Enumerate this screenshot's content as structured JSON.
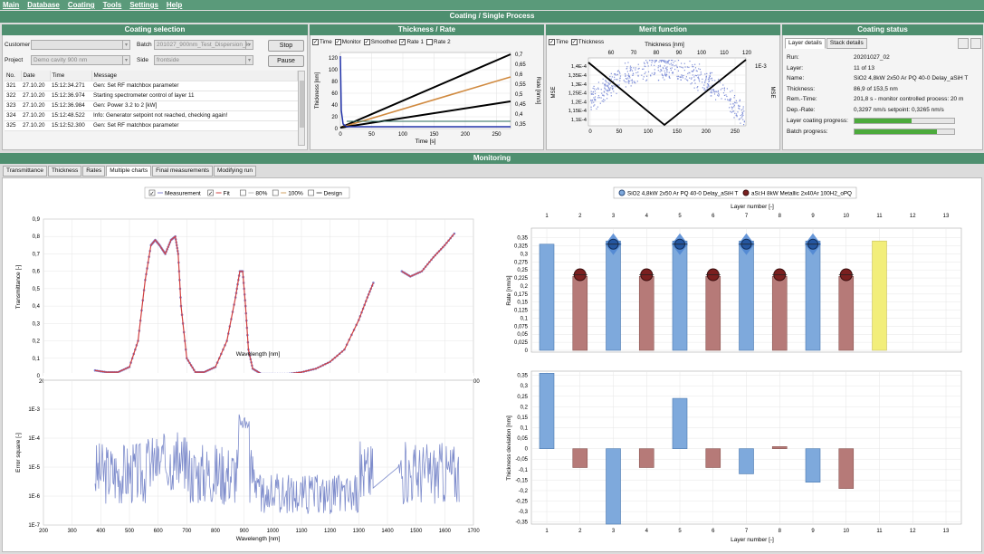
{
  "menu": [
    "Main",
    "Database",
    "Coating",
    "Tools",
    "Settings",
    "Help"
  ],
  "title": "Coating / Single Process",
  "coating_selection": {
    "header": "Coating selection",
    "customer_label": "Customer",
    "customer_value": "",
    "project_label": "Project",
    "project_value": "Demo cavity 900 nm",
    "batch_label": "Batch",
    "batch_value": "201027_900nm_Test_Dispersion_k",
    "side_label": "Side",
    "side_value": "frontside",
    "stop_label": "Stop",
    "pause_label": "Pause",
    "log_columns": [
      "No.",
      "Date",
      "Time",
      "Message"
    ],
    "log_rows": [
      [
        "321",
        "27.10.20",
        "15:12:34.271",
        "Gen: Set RF matchbox parameter"
      ],
      [
        "322",
        "27.10.20",
        "15:12:36.974",
        "Starting spectrometer control of layer 11"
      ],
      [
        "323",
        "27.10.20",
        "15:12:36.984",
        "Gen: Power 3.2 to 2 [kW]"
      ],
      [
        "324",
        "27.10.20",
        "15:12:48.522",
        "Info: Generator setpoint not reached, checking again!"
      ],
      [
        "325",
        "27.10.20",
        "15:12:52.300",
        "Gen: Set RF matchbox parameter"
      ]
    ]
  },
  "thickness_rate": {
    "header": "Thickness / Rate",
    "legend": [
      "Time",
      "Monitor",
      "Smoothed",
      "Rate 1",
      "Rate 2"
    ],
    "xlabel": "Time [s]",
    "ylabel": "Thickness [nm]",
    "y2label": "Rate [nm/s]",
    "xticks": [
      "0",
      "50",
      "100",
      "150",
      "200",
      "250"
    ],
    "yticks": [
      "0",
      "20",
      "40",
      "60",
      "80",
      "100",
      "120"
    ],
    "y2ticks": [
      "0,35",
      "0,4",
      "0,45",
      "0,5",
      "0,55",
      "0,6",
      "0,65",
      "0,7"
    ]
  },
  "merit": {
    "header": "Merit function",
    "legend": [
      "Time",
      "Thickness"
    ],
    "top_label": "Thickness [nm]",
    "top_ticks": [
      "60",
      "70",
      "80",
      "90",
      "100",
      "110",
      "120"
    ],
    "xticks": [
      "0",
      "50",
      "100",
      "150",
      "200",
      "250"
    ],
    "yticks": [
      "1,1E-4",
      "1,15E-4",
      "1,2E-4",
      "1,25E-4",
      "1,3E-4",
      "1,35E-4",
      "1,4E-4"
    ],
    "ylabel": "MSE",
    "y2label": "MSE",
    "y2tick": "1E-3"
  },
  "status": {
    "header": "Coating status",
    "tabs": [
      "Layer details",
      "Stack details"
    ],
    "rows": [
      [
        "Run:",
        "20201027_02"
      ],
      [
        "Layer:",
        "11 of 13"
      ],
      [
        "Name:",
        "SiO2 4,8kW 2x50 Ar PQ 40-0 Delay_aSiH T"
      ],
      [
        "Thickness:",
        "86,9 of 153,5 nm"
      ],
      [
        "Rem.-Time:",
        "201,8 s - monitor controlled     process: 20 m"
      ],
      [
        "Dep.-Rate:",
        "0,3297 nm/s   setpoint: 0,3265 nm/s"
      ]
    ],
    "layer_progress_label": "Layer coating progress:",
    "layer_progress": 0.57,
    "batch_progress_label": "Batch progress:",
    "batch_progress": 0.83
  },
  "monitoring": {
    "header": "Monitoring",
    "tabs": [
      "Transmittance",
      "Thickness",
      "Rates",
      "Multiple charts",
      "Final measurements",
      "Modifying run"
    ],
    "active_tab": "Multiple charts",
    "trans_legend": [
      "Measurement",
      "Fit",
      "80%",
      "100%",
      "Design"
    ],
    "layer_legend": [
      "SiO2 4,8kW 2x50 Ar PQ 40-0 Delay_aSiH T",
      "aSi:H 8kW Metallic 2x40Ar 100H2_oPQ"
    ]
  },
  "colors": {
    "sio2": "#7ea9dc",
    "asi": "#b67a78",
    "current": "#f2ee7a",
    "meas": "#8080d0",
    "fit": "#d04040"
  },
  "chart_data": [
    {
      "type": "scatter",
      "id": "transmittance",
      "xlabel": "Wavelength [nm]",
      "ylabel": "Transmittance [-]",
      "xlim": [
        200,
        1700
      ],
      "ylim": [
        0,
        0.9
      ],
      "xticks": [
        200,
        300,
        400,
        500,
        600,
        700,
        800,
        900,
        1000,
        1100,
        1200,
        1300,
        1400,
        1500,
        1600,
        1700
      ],
      "yticks": [
        0,
        0.1,
        0.2,
        0.3,
        0.4,
        0.5,
        0.6,
        0.7,
        0.8,
        0.9
      ],
      "ytick_labels": [
        "0",
        "0,1",
        "0,2",
        "0,3",
        "0,4",
        "0,5",
        "0,6",
        "0,7",
        "0,8",
        "0,9"
      ],
      "series": [
        {
          "name": "Measurement",
          "x": [
            380,
            420,
            460,
            500,
            530,
            555,
            575,
            590,
            605,
            625,
            645,
            660,
            670,
            680,
            700,
            730,
            760,
            800,
            840,
            870,
            885,
            895,
            905,
            915,
            930,
            960,
            1000,
            1050,
            1100,
            1150,
            1200,
            1250,
            1300,
            1330,
            1355,
            1450,
            1480,
            1520,
            1560,
            1600,
            1640
          ],
          "y": [
            0.03,
            0.02,
            0.02,
            0.05,
            0.2,
            0.55,
            0.75,
            0.78,
            0.75,
            0.7,
            0.78,
            0.8,
            0.7,
            0.4,
            0.1,
            0.02,
            0.02,
            0.05,
            0.2,
            0.45,
            0.6,
            0.6,
            0.4,
            0.15,
            0.04,
            0.01,
            0.01,
            0.01,
            0.02,
            0.04,
            0.08,
            0.15,
            0.32,
            0.45,
            0.55,
            0.6,
            0.57,
            0.6,
            0.68,
            0.75,
            0.83
          ]
        }
      ]
    },
    {
      "type": "line",
      "id": "error_square",
      "xlabel": "Wavelength [nm]",
      "ylabel": "Error square [-]",
      "yscale": "log",
      "xlim": [
        200,
        1700
      ],
      "ylim": [
        1e-07,
        0.01
      ],
      "xticks": [
        200,
        300,
        400,
        500,
        600,
        700,
        800,
        900,
        1000,
        1100,
        1200,
        1300,
        1400,
        1500,
        1600,
        1700
      ],
      "ytick_labels": [
        "1E-7",
        "1E-6",
        "1E-5",
        "1E-4",
        "1E-3"
      ]
    },
    {
      "type": "bar",
      "id": "rate",
      "xlabel": "Layer number [-]",
      "ylabel": "Rate [nm/s]",
      "categories": [
        1,
        2,
        3,
        4,
        5,
        6,
        7,
        8,
        9,
        10,
        11,
        12,
        13
      ],
      "ylim": [
        0,
        0.38
      ],
      "yticks": [
        0,
        0.025,
        0.05,
        0.075,
        0.1,
        0.125,
        0.15,
        0.175,
        0.2,
        0.225,
        0.25,
        0.275,
        0.3,
        0.325,
        0.35
      ],
      "values": [
        0.33,
        0.23,
        0.34,
        0.23,
        0.34,
        0.23,
        0.34,
        0.23,
        0.34,
        0.23,
        0.34,
        null,
        null
      ],
      "setpoints": [
        null,
        0.235,
        0.33,
        0.235,
        0.33,
        0.235,
        0.33,
        0.235,
        0.33,
        0.235,
        null,
        null,
        null
      ]
    },
    {
      "type": "bar",
      "id": "thickness_deviation",
      "xlabel": "Layer number [-]",
      "ylabel": "Thickness deviation [nm]",
      "categories": [
        1,
        2,
        3,
        4,
        5,
        6,
        7,
        8,
        9,
        10,
        11,
        12,
        13
      ],
      "ylim": [
        -0.36,
        0.37
      ],
      "yticks": [
        -0.35,
        -0.3,
        -0.25,
        -0.2,
        -0.15,
        -0.1,
        -0.05,
        0,
        0.05,
        0.1,
        0.15,
        0.2,
        0.25,
        0.3,
        0.35
      ],
      "values": [
        0.36,
        -0.09,
        -0.36,
        -0.09,
        0.24,
        -0.09,
        -0.12,
        0.01,
        -0.16,
        -0.19,
        null,
        null,
        null
      ]
    }
  ]
}
